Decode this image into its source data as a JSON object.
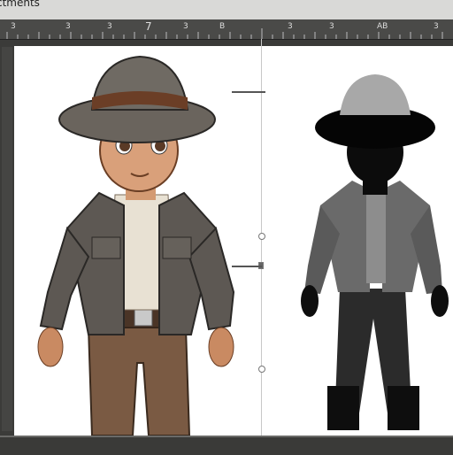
{
  "window": {
    "title": "ctments"
  },
  "ruler": {
    "labels": [
      "3",
      "3",
      "7",
      "3",
      "B",
      "3",
      "3",
      "3",
      "AB",
      "3"
    ]
  },
  "canvas": {
    "figure_left": "boy in brimmed hat, jacket and brown pants",
    "figure_right": "dark silhouette of the same character in hat and jacket"
  }
}
